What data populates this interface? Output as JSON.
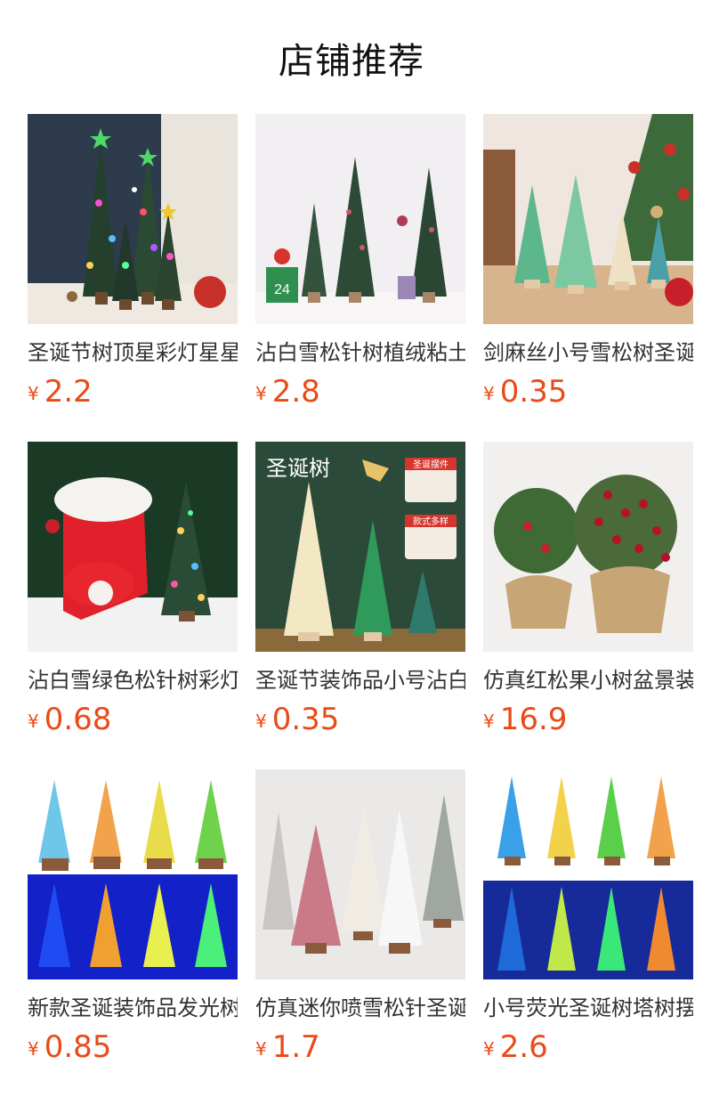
{
  "section_title": "店铺推荐",
  "products": [
    {
      "name": "圣诞节树顶星彩灯星星",
      "currency": "¥",
      "price": "2.2"
    },
    {
      "name": "沾白雪松针树植绒粘土",
      "currency": "¥",
      "price": "2.8"
    },
    {
      "name": "剑麻丝小号雪松树圣诞",
      "currency": "¥",
      "price": "0.35"
    },
    {
      "name": "沾白雪绿色松针树彩灯",
      "currency": "¥",
      "price": "0.68"
    },
    {
      "name": "圣诞节装饰品小号沾白",
      "currency": "¥",
      "price": "0.35"
    },
    {
      "name": "仿真红松果小树盆景装",
      "currency": "¥",
      "price": "16.9"
    },
    {
      "name": "新款圣诞装饰品发光树",
      "currency": "¥",
      "price": "0.85"
    },
    {
      "name": "仿真迷你喷雪松针圣诞",
      "currency": "¥",
      "price": "1.7"
    },
    {
      "name": "小号荧光圣诞树塔树摆",
      "currency": "¥",
      "price": "2.6"
    }
  ],
  "image_texts": {
    "p5_title": "圣诞树",
    "p5_badge_top": "圣诞摆件",
    "p5_badge_bottom": "款式多样",
    "p2_calendar_day": "24"
  },
  "colors": {
    "price": "#e94b18",
    "title": "#111111",
    "name": "#333333"
  }
}
